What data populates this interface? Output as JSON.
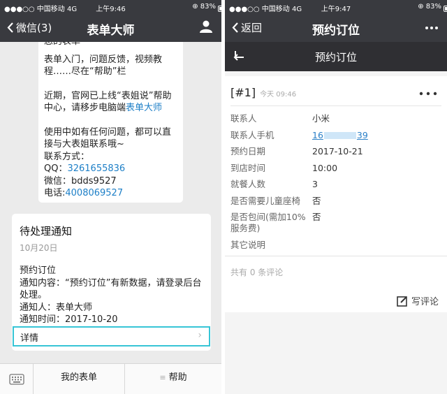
{
  "left": {
    "status": {
      "carrier": "●●●○○ 中国移动  4G",
      "time": "上午9:46",
      "battery": "⊕ 83%"
    },
    "nav": {
      "back": "微信(3)",
      "title": "表单大师"
    },
    "message": {
      "cut_line": "您的表单",
      "p1": "表单入门，问题反馈，视频教程……尽在“帮助”栏",
      "p2_before": "近期，官网已上线“表姐说”帮助中心，请移步电脑端",
      "p2_link": "表单大师",
      "p3_line1": "使用中如有任何问题，都可以直接与大表姐联系哦~",
      "p3_line2": "联系方式：",
      "qq_label": "QQ：",
      "qq_value": "3261655836",
      "wechat_label": "微信：",
      "wechat_value": "bdds9527",
      "phone_label": "电话:",
      "phone_value": "4008069527"
    },
    "card": {
      "title": "待处理通知",
      "date": "10月20日",
      "line1": "预约订位",
      "line2": "通知内容：“预约订位”有新数据，请登录后台处理。",
      "line3": "通知人：表单大师",
      "line4": "通知时间：2017-10-20",
      "detail": "详情"
    },
    "bottom": {
      "tab1": "我的表单",
      "tab2": "帮助"
    }
  },
  "right": {
    "status": {
      "carrier": "●●●○○ 中国移动  4G",
      "time": "上午9:47",
      "battery": "⊕ 83%"
    },
    "nav": {
      "back": "返回",
      "title": "预约订位"
    },
    "subbar_title": "预约订位",
    "record": {
      "id": "[#1]",
      "time": "今天 09:46"
    },
    "fields": [
      {
        "label": "联系人",
        "value": "小米"
      },
      {
        "label": "联系人手机",
        "value_prefix": "16",
        "value_suffix": "39"
      },
      {
        "label": "预约日期",
        "value": "2017-10-21"
      },
      {
        "label": "到店时间",
        "value": "10:00"
      },
      {
        "label": "就餐人数",
        "value": "3"
      },
      {
        "label": "是否需要儿童座椅",
        "value": "否"
      },
      {
        "label": "是否包间(需加10%服务费)",
        "value": "否"
      },
      {
        "label": "其它说明",
        "value": ""
      }
    ],
    "comments": {
      "count_text": "共有 0 条评论",
      "write": "写评论"
    }
  }
}
